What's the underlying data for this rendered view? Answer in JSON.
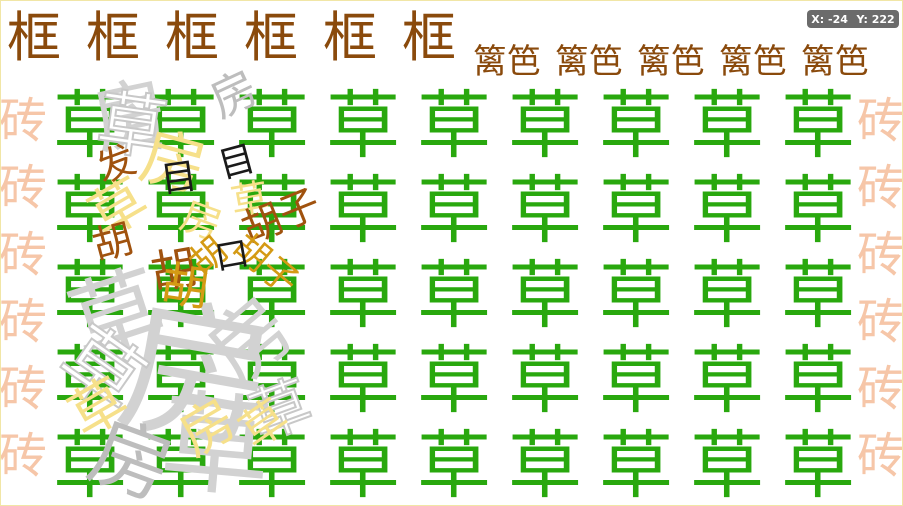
{
  "tiles": {
    "frame": "框",
    "fence": "篱笆",
    "grass": "草",
    "brick": "砖"
  },
  "debris": {
    "house": "房",
    "grass": "草",
    "hair": "发",
    "eye": "目",
    "beard": "胡",
    "huzi": "胡子",
    "mouth": "口",
    "baize": "白",
    "kou": "口"
  },
  "coordinates": {
    "x_label": "X: -24",
    "y_label": "Y: 222"
  },
  "colors": {
    "frame": "#8a4a0c",
    "grass": "#29a80e",
    "brick": "#f6c6a8",
    "debris_gray": "#d2d2d2",
    "debris_gold": "#f6e08a",
    "coord_badge": "#6b6b6b"
  }
}
